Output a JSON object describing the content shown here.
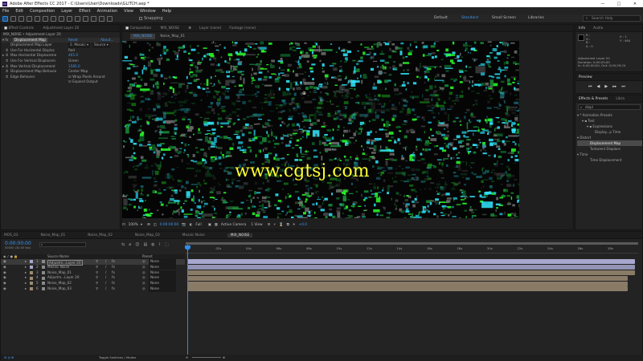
{
  "window": {
    "title": "Adobe After Effects CC 2017 - C:\\Users\\User\\Downloads\\GLITCH.aep *",
    "logo_text": "Ae",
    "minimize": "—",
    "maximize": "□",
    "close": "✕"
  },
  "menu": [
    "File",
    "Edit",
    "Composition",
    "Layer",
    "Effect",
    "Animation",
    "View",
    "Window",
    "Help"
  ],
  "toolbar": {
    "snapping_label": "Snapping",
    "workspaces": [
      "Default",
      "Standard",
      "Small Screen",
      "Libraries"
    ],
    "active_workspace": "Standard",
    "search_placeholder": "Search Help"
  },
  "effect_controls": {
    "tab_label": "Effect Controls",
    "tab_layer": "Adjustment Layer 20",
    "header": "MIX_NOISE • Adjustment Layer 20",
    "effect_name": "Displacement Map",
    "reset_label": "Reset",
    "about_label": "About...",
    "properties": [
      {
        "label": "Displacement Map Layer",
        "value": "2. Mosaic ▾",
        "value2": "Source ▾"
      },
      {
        "label": "Use For Horizontal Displac",
        "value": "Red",
        "value2": ""
      },
      {
        "label": "Max Horizontal Displaceme",
        "value": "465.0",
        "value2": ""
      },
      {
        "label": "Use For Vertical Displacem",
        "value": "Green",
        "value2": ""
      },
      {
        "label": "Max Vertical Displacement",
        "value": "1585.0",
        "value2": ""
      },
      {
        "label": "Displacement Map Behavio",
        "value": "Center Map",
        "value2": ""
      },
      {
        "label": "Edge Behavior",
        "value": "☑ Wrap Pixels Around",
        "value2": ""
      },
      {
        "label": "",
        "value": "☑ Expand Output",
        "value2": ""
      }
    ]
  },
  "composition_panel": {
    "tab_label": "Composition",
    "tab_comp": "MIX_NOISE",
    "layer_tab": "Layer (none)",
    "footage_tab": "Footage (none)",
    "subtabs": [
      "MIX_NOISE",
      "Noise_Map_01"
    ],
    "watermark": "www.cgtsj.com",
    "footer": {
      "zoom": "100%",
      "timecode": "0:00:00:00",
      "resolution": "Full",
      "camera": "Active Camera",
      "views": "1 View",
      "offset": "+0.0"
    }
  },
  "info_panel": {
    "tabs": [
      "Info",
      "Audio"
    ],
    "readout": [
      "R :",
      "G :",
      "B :",
      "A : 0"
    ],
    "coords": [
      "X : 1",
      "Y : 464"
    ],
    "layer_name": "Adjustment Layer 20",
    "duration": "Duration: 0;00;05;00",
    "in_out": "In: 0;00;00;00, Out: 0;00;29;24"
  },
  "preview_panel": {
    "title": "Preview"
  },
  "effects_presets": {
    "tabs": [
      "Effects & Presets",
      "Libra"
    ],
    "search_value": "displ",
    "tree": [
      {
        "label": "▾ * Animation Presets",
        "indent": 0
      },
      {
        "label": "▾ ▪ Text",
        "indent": 1
      },
      {
        "label": "▾ ▪ Expressions",
        "indent": 2
      },
      {
        "label": "Display...p Time",
        "indent": 3
      },
      {
        "label": "▾ Distort",
        "indent": 0
      },
      {
        "label": "Displacement Map",
        "indent": 1,
        "selected": true
      },
      {
        "label": "Turbulent Displace",
        "indent": 1
      },
      {
        "label": "▾ Time",
        "indent": 0
      },
      {
        "label": "Time Displacement",
        "indent": 1
      }
    ]
  },
  "timeline": {
    "comp_tabs": [
      "MOS_03",
      "Noise_Map_01",
      "Noise_Map_02",
      "Noise_Map_03",
      "Mosaic Noise",
      "MIX_NOISE"
    ],
    "active_tab": "MIX_NOISE",
    "current_time": "0:00:00:00",
    "frame_info": "00000 (30.00 fps)",
    "columns": {
      "source_name": "Source Name",
      "parent": "Parent"
    },
    "ruler": [
      "0s",
      "02s",
      "04s",
      "06s",
      "08s",
      "10s",
      "12s",
      "14s",
      "16s",
      "18s",
      "20s",
      "22s",
      "24s",
      "26s",
      "28s"
    ],
    "layers": [
      {
        "num": "1",
        "name": "Adjustm...Layer 20",
        "parent": "None",
        "selected": true,
        "color": "#a7a7ce"
      },
      {
        "num": "2",
        "name": "Mosaic Noise",
        "parent": "None",
        "selected": false,
        "color": "#a7a7ce"
      },
      {
        "num": "3",
        "name": "Noise_Map_01",
        "parent": "None",
        "selected": false,
        "color": "#9c8b73"
      },
      {
        "num": "4",
        "name": "Adjustm...Layer 20",
        "parent": "None",
        "selected": false,
        "color": "#9c8b73"
      },
      {
        "num": "5",
        "name": "Noise_Map_02",
        "parent": "None",
        "selected": false,
        "color": "#9c8b73"
      },
      {
        "num": "6",
        "name": "Noise_Map_03",
        "parent": "None",
        "selected": false,
        "color": "#9c8b73"
      }
    ],
    "footer_label": "Toggle Switches / Modes"
  },
  "colors": {
    "accent_blue": "#2d8ceb",
    "noise_green": "#2cff2c",
    "noise_cyan": "#33e9ff",
    "watermark": "#ffff33"
  }
}
